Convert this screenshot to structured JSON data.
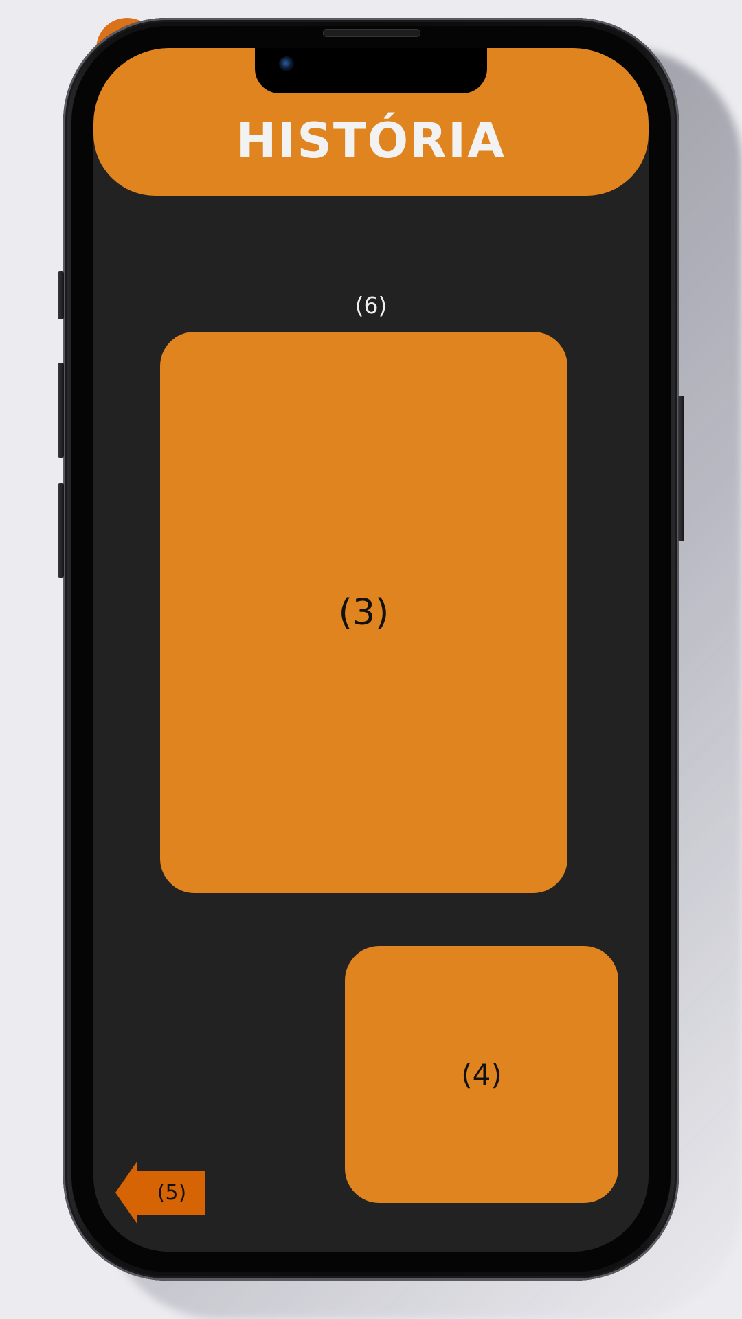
{
  "header": {
    "title": "HISTÓRIA"
  },
  "main": {
    "label_top": "(6)",
    "card_main_label": "(3)",
    "card_small_label": "(4)",
    "back_button_label": "(5)"
  },
  "colors": {
    "accent": "#e0841f",
    "back_button": "#d66404",
    "screen_bg": "#222222",
    "page_bg": "#ececf0"
  },
  "icons": {
    "back": "arrow-left-icon"
  }
}
